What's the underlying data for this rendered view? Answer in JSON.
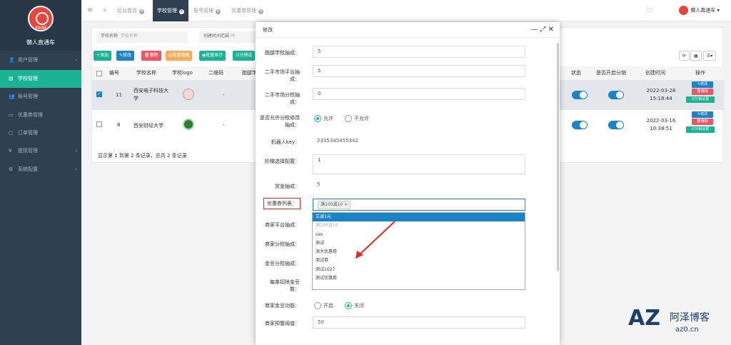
{
  "brand": {
    "logo_text": "泉路酒精",
    "title": "懒人直通车"
  },
  "sidebar": {
    "items": [
      {
        "icon": "👤",
        "label": "用户管理",
        "arrow": "‹"
      },
      {
        "icon": "▤",
        "label": "学校管理",
        "arrow": ""
      },
      {
        "icon": "👥",
        "label": "账号管理",
        "arrow": ""
      },
      {
        "icon": "▭",
        "label": "优惠券管理",
        "arrow": ""
      },
      {
        "icon": "▢",
        "label": "订单管理",
        "arrow": ""
      },
      {
        "icon": "¥",
        "label": "提现管理",
        "arrow": "‹"
      },
      {
        "icon": "⚙",
        "label": "系统配置",
        "arrow": "‹"
      }
    ]
  },
  "topbar": {
    "menu_icon": "≡",
    "back_icon": "«",
    "tabs": [
      "后台首页",
      "学校管理",
      "账号管理",
      "优惠券管理"
    ],
    "tab_close": "×",
    "expand_icon": "⛶",
    "user": "懒人直通车 ▾"
  },
  "search": {
    "school_label": "学校名称",
    "school_placeholder": "学校名称",
    "time_label": "创建时间范围",
    "time_placeholder": "时"
  },
  "toolbar": {
    "add": "+添加",
    "edit": "✎修改",
    "delete": "🗑删除",
    "batch_hide": "◎批量隐藏",
    "batch_show": "◉批量显示",
    "dist": "☑分销设"
  },
  "right_tools": [
    "⟳",
    "▦",
    "☰▾"
  ],
  "table": {
    "headers": [
      "",
      "编号",
      "学校名称",
      "学校logo",
      "二维码",
      "跑腿学",
      "状态",
      "是否开启分销",
      "创建时间",
      "操作"
    ],
    "rows": [
      {
        "id": "11",
        "name": "西安电子科技大学",
        "qr": "-",
        "created": "2022-03-28 15:18:44"
      },
      {
        "id": "8",
        "name": "西安财经大学",
        "qr": "-",
        "created": "2022-03-16 10:38:51"
      }
    ],
    "ops": {
      "edit": "✎修改",
      "del": "🗑删除",
      "dist": "☑分销设置"
    },
    "footer": "显示第 1 到第 2 条记录，总共 2 条记录"
  },
  "modal": {
    "title": "修改",
    "controls": "— ⤢ ✕",
    "fields": [
      {
        "label": "跑腿学校抽成：",
        "value": "5"
      },
      {
        "label": "二手市场平台抽成：",
        "value": "5"
      },
      {
        "label": "二手市场分校抽成：",
        "value": "0"
      },
      {
        "label": "是否允许分校修改抽成：",
        "allow": "允许",
        "deny": "不允许"
      },
      {
        "label": "机器人key：",
        "value": "2335345455342"
      },
      {
        "label": "阶梯选择配置：",
        "value": "1"
      },
      {
        "label": "赏金抽成：",
        "value": "5"
      },
      {
        "label": "优惠券列表：",
        "tag": "满100减10"
      },
      {
        "label": "商家平台抽成："
      },
      {
        "label": "商家分校抽成："
      },
      {
        "label": "金豆分校抽成："
      },
      {
        "label": "每单扣除金豆数："
      },
      {
        "label": "商家金豆功能：",
        "on": "开启",
        "off": "关闭"
      },
      {
        "label": "商家预警阈值：",
        "value": "50"
      }
    ],
    "options": [
      "立减1元",
      "满100减10",
      "ces",
      "测试",
      "海大优惠券",
      "测试券",
      "测试1027",
      "测试优惠券"
    ]
  },
  "watermark": {
    "logo": "AZ",
    "name": "阿泽博客",
    "url": "az0.cn"
  },
  "colors": {
    "accent": "#1ab394",
    "primary": "#1c84c6",
    "danger": "#ed5565",
    "warning": "#f8ac59",
    "sidebar": "#2f4050",
    "arrow": "#e8261e"
  }
}
